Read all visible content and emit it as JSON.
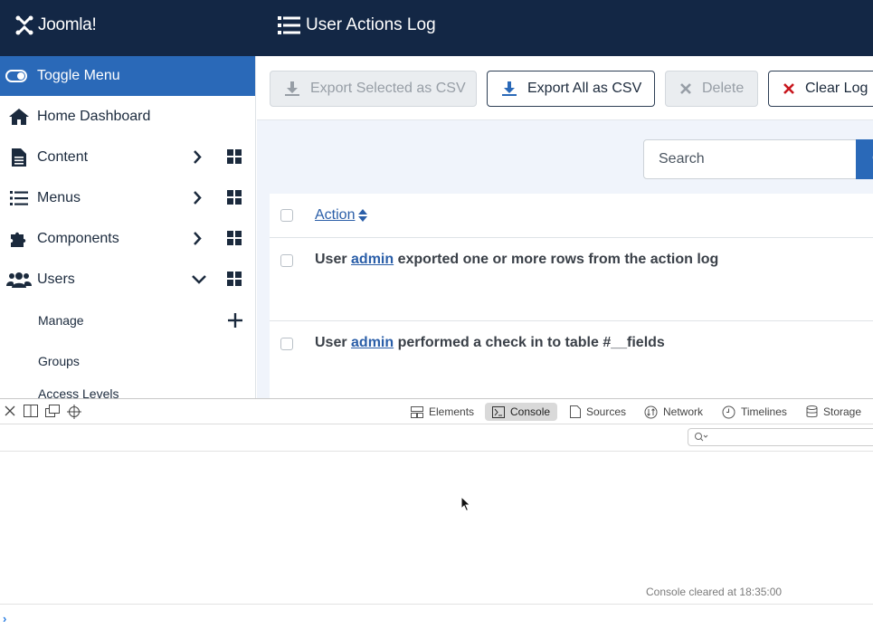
{
  "header": {
    "logo_text": "Joomla!",
    "title": "User Actions Log",
    "background": "#132745"
  },
  "sidebar": {
    "toggle_label": "Toggle Menu",
    "items": [
      {
        "label": "Home Dashboard",
        "icon": "home-icon"
      },
      {
        "label": "Content",
        "icon": "file-icon"
      },
      {
        "label": "Menus",
        "icon": "list-icon"
      },
      {
        "label": "Components",
        "icon": "puzzle-icon"
      },
      {
        "label": "Users",
        "icon": "users-icon"
      }
    ],
    "sub_items": [
      {
        "label": "Manage"
      },
      {
        "label": "Groups"
      },
      {
        "label": "Access Levels"
      }
    ],
    "accent": "#2a69b8"
  },
  "toolbar": {
    "export_selected": "Export Selected as CSV",
    "export_all": "Export All as CSV",
    "delete": "Delete",
    "clear_log": "Clear Log"
  },
  "search": {
    "placeholder": "Search"
  },
  "table": {
    "header": "Action",
    "rows": [
      {
        "prefix": "User",
        "user": "admin",
        "text": "exported one or more rows from the action log"
      },
      {
        "prefix": "User",
        "user": "admin",
        "text": "performed a check in to table #__fields"
      }
    ]
  },
  "devtools": {
    "tabs": [
      {
        "label": "Elements",
        "icon": "elements-icon"
      },
      {
        "label": "Console",
        "icon": "console-icon"
      },
      {
        "label": "Sources",
        "icon": "document-icon"
      },
      {
        "label": "Network",
        "icon": "network-icon"
      },
      {
        "label": "Timelines",
        "icon": "clock-icon"
      },
      {
        "label": "Storage",
        "icon": "database-icon"
      }
    ],
    "active_tab": "Console",
    "console_message": "Console cleared at 18:35:00",
    "prompt": "›"
  }
}
